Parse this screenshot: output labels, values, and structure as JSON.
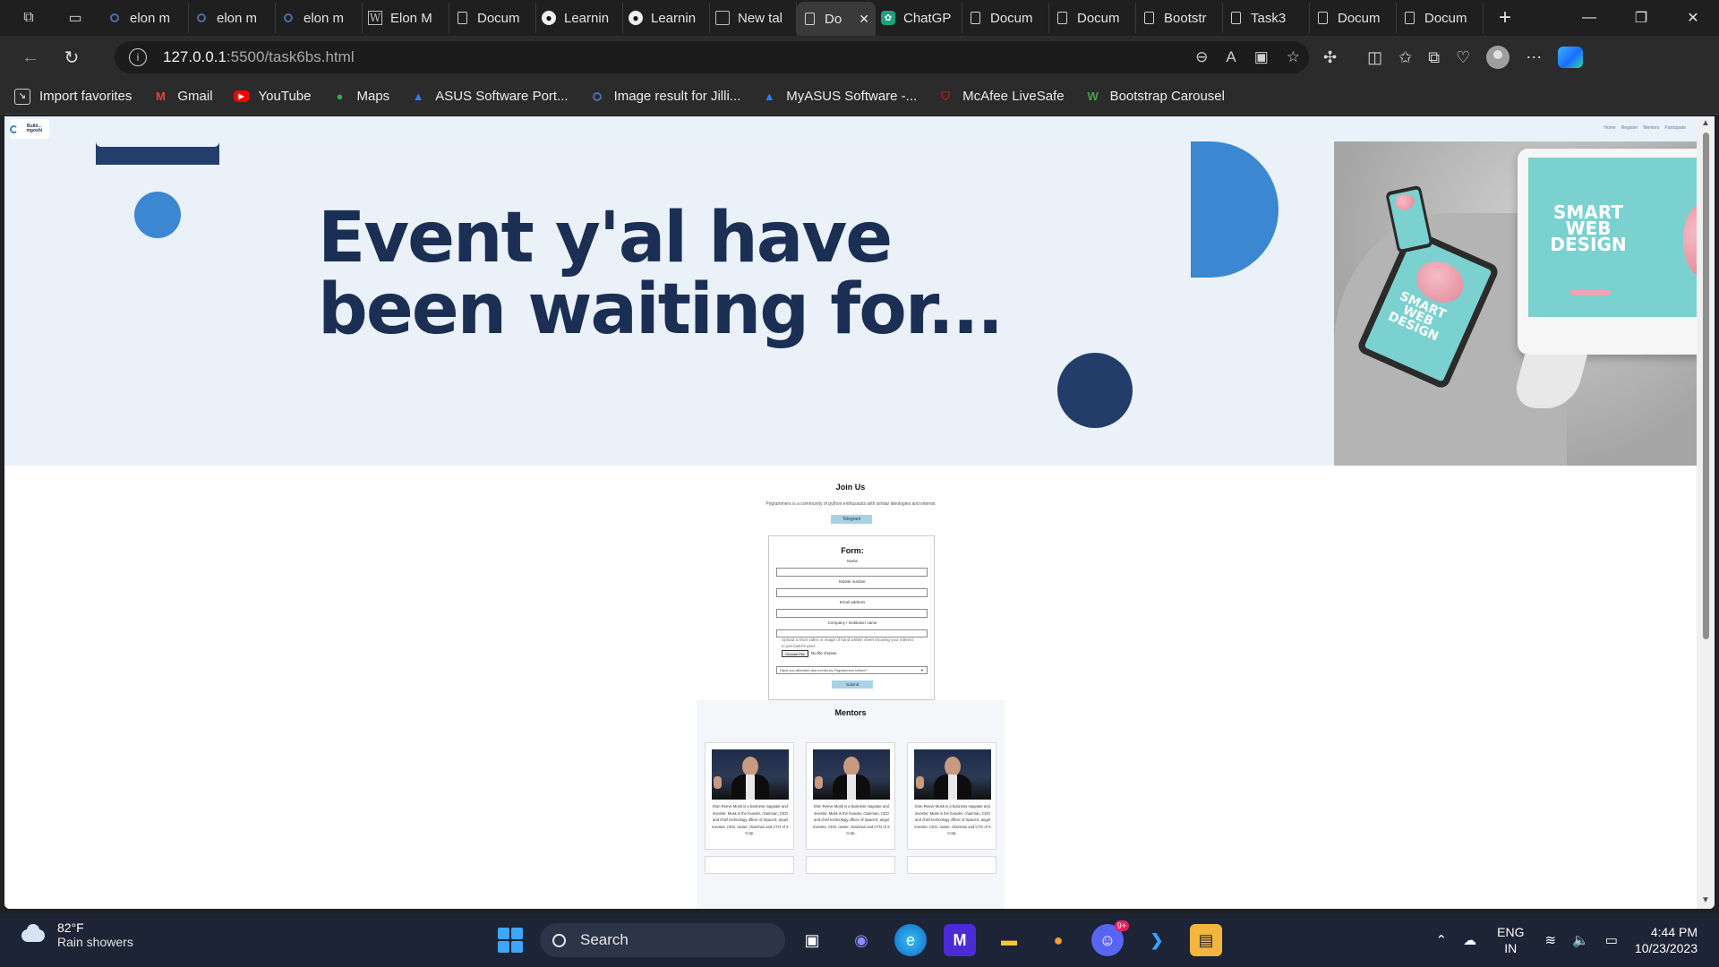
{
  "browser": {
    "tabs": [
      {
        "label": "elon m",
        "icon": "search-icon"
      },
      {
        "label": "elon m",
        "icon": "search-icon"
      },
      {
        "label": "elon m",
        "icon": "search-icon"
      },
      {
        "label": "Elon M",
        "icon": "wikipedia-icon"
      },
      {
        "label": "Docum",
        "icon": "document-icon"
      },
      {
        "label": "Learnin",
        "icon": "github-icon"
      },
      {
        "label": "Learnin",
        "icon": "github-icon"
      },
      {
        "label": "New tal",
        "icon": "newtab-icon"
      },
      {
        "label": "Do",
        "icon": "document-icon",
        "active": true
      },
      {
        "label": "ChatGP",
        "icon": "chatgpt-icon"
      },
      {
        "label": "Docum",
        "icon": "document-icon"
      },
      {
        "label": "Docum",
        "icon": "document-icon"
      },
      {
        "label": "Bootstr",
        "icon": "document-icon"
      },
      {
        "label": "Task3",
        "icon": "document-icon"
      },
      {
        "label": "Docum",
        "icon": "document-icon"
      },
      {
        "label": "Docum",
        "icon": "document-icon"
      }
    ],
    "url_host": "127.0.0.1",
    "url_rest": ":5500/task6bs.html",
    "favorites": [
      {
        "label": "Import favorites",
        "icon": "import-icon"
      },
      {
        "label": "Gmail",
        "icon": "gmail-icon"
      },
      {
        "label": "YouTube",
        "icon": "youtube-icon"
      },
      {
        "label": "Maps",
        "icon": "maps-icon"
      },
      {
        "label": "ASUS Software Port...",
        "icon": "asus-icon"
      },
      {
        "label": "Image result for Jilli...",
        "icon": "search-icon"
      },
      {
        "label": "MyASUS Software -...",
        "icon": "asus-icon"
      },
      {
        "label": "McAfee LiveSafe",
        "icon": "mcafee-icon"
      },
      {
        "label": "Bootstrap Carousel",
        "icon": "bootstrap-icon"
      }
    ]
  },
  "site": {
    "logo_text": "Build... mgoshi",
    "nav_links": [
      "Home",
      "Register",
      "Mentors",
      "Participate"
    ],
    "hero": {
      "title": "Event y'al have been waiting for...",
      "art_text": "SMART WEB DESIGN",
      "colors": {
        "bg": "#eaf1f9",
        "navy": "#1b2f55",
        "blue": "#3b87d1"
      }
    },
    "join": {
      "title": "Join Us",
      "subtitle": "Pygrammers is a community of python enthusiasts with similar ideologies and interest",
      "telegram_label": "Telegram"
    },
    "form": {
      "title": "Form:",
      "fields": [
        "Name",
        "Mobile number",
        "Email address",
        "Company / Institution name"
      ],
      "upload_note": "Upload a short video or image of hand written sheet showing your interest to join build-it-yard.",
      "file_button": "Choose File",
      "file_status": "No file chosen",
      "attended_select": "Have you attended any events by Pygrammers before?",
      "submit_label": "Submit"
    },
    "mentors": {
      "title": "Mentors",
      "bio": "Elon Reeve Musk is a business magnate and investor. Musk is the founder, chairman, CEO and chief technology officer of SpaceX; angel investor, CEO, owner, chairman and CTO of X Corp.."
    }
  },
  "taskbar": {
    "weather_temp": "82°F",
    "weather_desc": "Rain showers",
    "search_label": "Search",
    "lang_top": "ENG",
    "lang_bottom": "IN",
    "time": "4:44 PM",
    "date": "10/23/2023",
    "discord_badge": "9+"
  }
}
